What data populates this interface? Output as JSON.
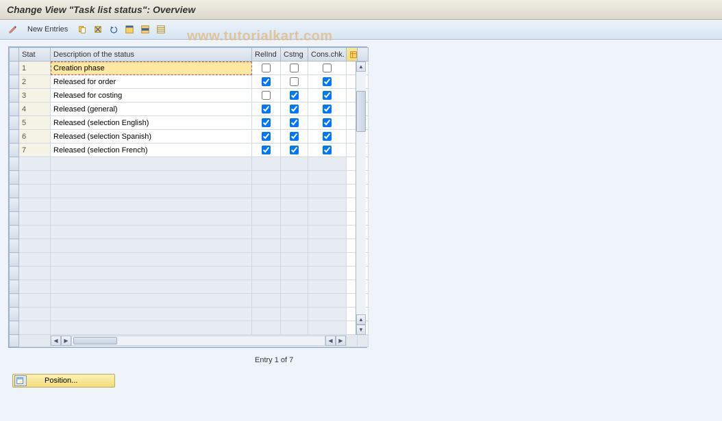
{
  "header": {
    "title": "Change View \"Task list status\": Overview"
  },
  "toolbar": {
    "new_entries_label": "New Entries"
  },
  "watermark": "www.tutorialkart.com",
  "table": {
    "columns": {
      "stat": "Stat",
      "desc": "Description of the status",
      "relind": "RelInd",
      "cstng": "Cstng",
      "cons": "Cons.chk."
    },
    "rows": [
      {
        "stat": "1",
        "desc": "Creation phase",
        "relind": false,
        "cstng": false,
        "cons": false,
        "active": true
      },
      {
        "stat": "2",
        "desc": "Released for order",
        "relind": true,
        "cstng": false,
        "cons": true,
        "active": false
      },
      {
        "stat": "3",
        "desc": "Released for costing",
        "relind": false,
        "cstng": true,
        "cons": true,
        "active": false
      },
      {
        "stat": "4",
        "desc": "Released (general)",
        "relind": true,
        "cstng": true,
        "cons": true,
        "active": false
      },
      {
        "stat": "5",
        "desc": "Released (selection English)",
        "relind": true,
        "cstng": true,
        "cons": true,
        "active": false
      },
      {
        "stat": "6",
        "desc": "Released (selection Spanish)",
        "relind": true,
        "cstng": true,
        "cons": true,
        "active": false
      },
      {
        "stat": "7",
        "desc": "Released (selection French)",
        "relind": true,
        "cstng": true,
        "cons": true,
        "active": false
      }
    ],
    "empty_row_count": 13
  },
  "footer": {
    "entry_status": "Entry 1 of 7",
    "position_label": "Position..."
  }
}
